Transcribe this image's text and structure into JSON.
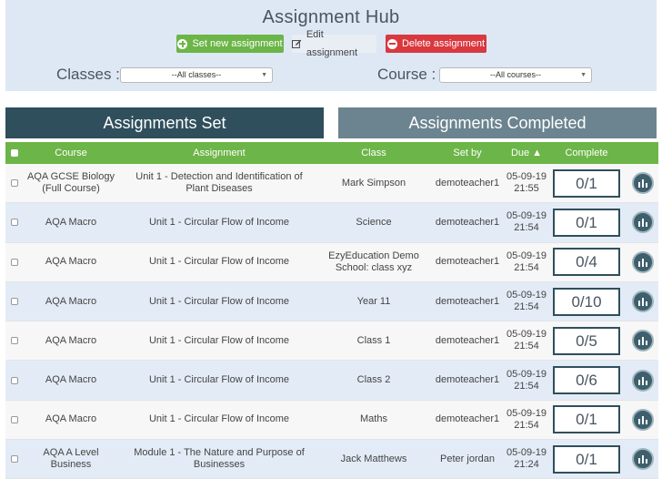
{
  "header": {
    "title": "Assignment Hub",
    "set_label": "Set new assignment",
    "edit_label": "Edit assignment",
    "delete_label": "Delete assignment"
  },
  "filters": {
    "classes_label": "Classes :",
    "classes_value": "--All classes--",
    "course_label": "Course :",
    "course_value": "--All courses--"
  },
  "tabs": {
    "set": "Assignments Set",
    "completed": "Assignments Completed"
  },
  "table": {
    "headers": {
      "course": "Course",
      "assignment": "Assignment",
      "class": "Class",
      "set_by": "Set by",
      "due": "Due ▲",
      "complete": "Complete"
    },
    "rows": [
      {
        "course": "AQA GCSE Biology (Full Course)",
        "assignment": "Unit 1 - Detection and Identification of Plant Diseases",
        "class": "Mark Simpson",
        "set_by": "demoteacher1",
        "due_date": "05-09-19",
        "due_time": "21:55",
        "complete": "0/1"
      },
      {
        "course": "AQA Macro",
        "assignment": "Unit 1 - Circular Flow of Income",
        "class": "Science",
        "set_by": "demoteacher1",
        "due_date": "05-09-19",
        "due_time": "21:54",
        "complete": "0/1"
      },
      {
        "course": "AQA Macro",
        "assignment": "Unit 1 - Circular Flow of Income",
        "class": "EzyEducation Demo School: class xyz",
        "set_by": "demoteacher1",
        "due_date": "05-09-19",
        "due_time": "21:54",
        "complete": "0/4"
      },
      {
        "course": "AQA Macro",
        "assignment": "Unit 1 - Circular Flow of Income",
        "class": "Year 11",
        "set_by": "demoteacher1",
        "due_date": "05-09-19",
        "due_time": "21:54",
        "complete": "0/10"
      },
      {
        "course": "AQA Macro",
        "assignment": "Unit 1 - Circular Flow of Income",
        "class": "Class 1",
        "set_by": "demoteacher1",
        "due_date": "05-09-19",
        "due_time": "21:54",
        "complete": "0/5"
      },
      {
        "course": "AQA Macro",
        "assignment": "Unit 1 - Circular Flow of Income",
        "class": "Class 2",
        "set_by": "demoteacher1",
        "due_date": "05-09-19",
        "due_time": "21:54",
        "complete": "0/6"
      },
      {
        "course": "AQA Macro",
        "assignment": "Unit 1 - Circular Flow of Income",
        "class": "Maths",
        "set_by": "demoteacher1",
        "due_date": "05-09-19",
        "due_time": "21:54",
        "complete": "0/1"
      },
      {
        "course": "AQA A Level Business",
        "assignment": "Module 1 - The Nature and Purpose of Businesses",
        "class": "Jack Matthews",
        "set_by": "Peter jordan",
        "due_date": "05-09-19",
        "due_time": "21:24",
        "complete": "0/1"
      }
    ]
  },
  "icons": {
    "set": "plus-circle-icon",
    "edit": "edit-icon",
    "delete": "minus-circle-icon",
    "report": "chart-report-icon"
  },
  "colors": {
    "green": "#6cb548",
    "red": "#d9383f",
    "tab_active": "#2f4f5c",
    "tab_inactive": "#6b848f",
    "panel": "#dde8f4"
  }
}
